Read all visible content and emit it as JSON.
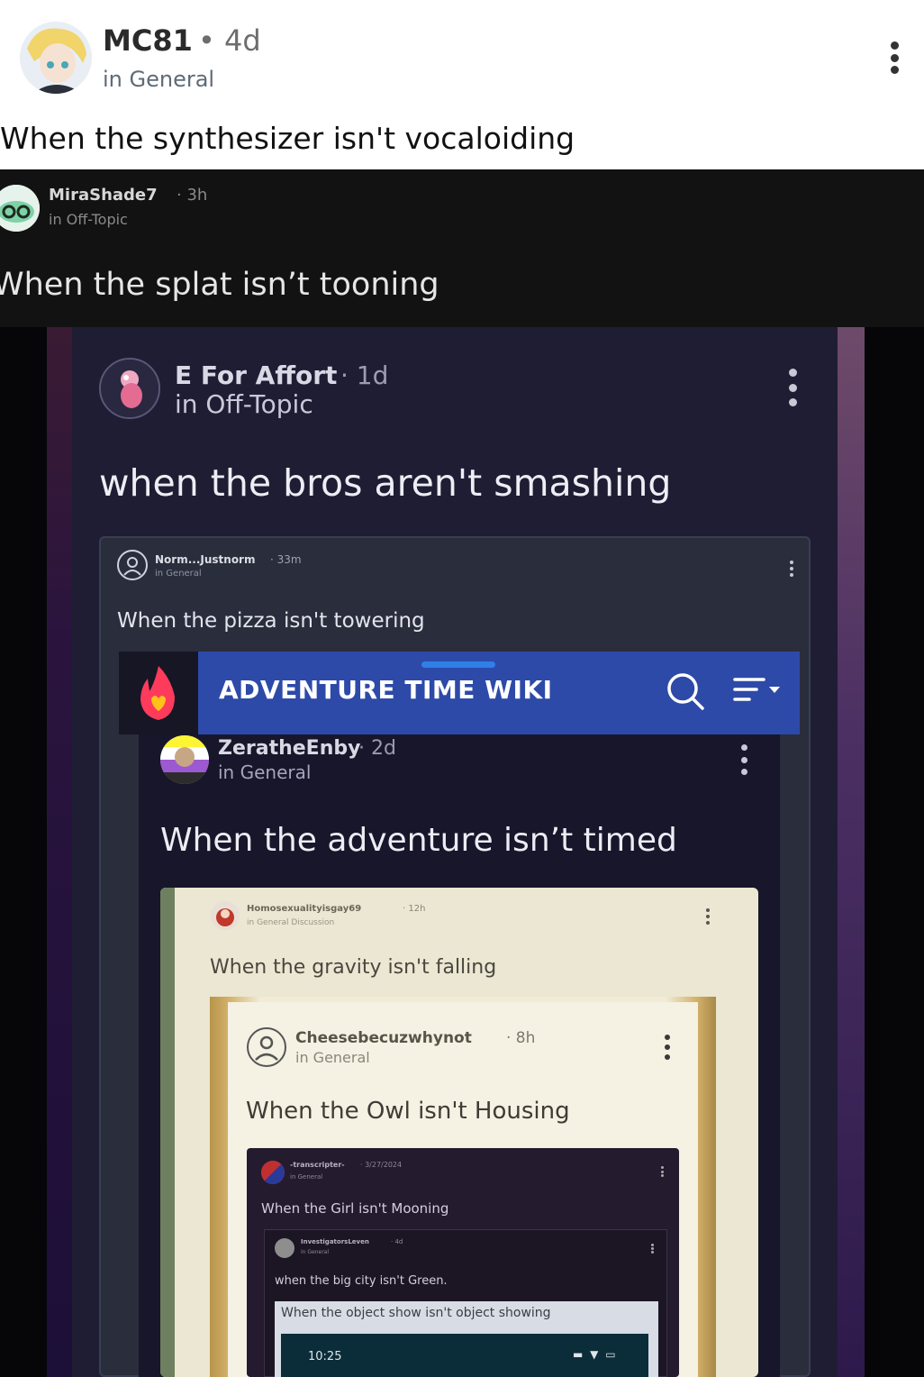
{
  "post": {
    "username": "MC81",
    "time": "• 4d",
    "category": "in General",
    "title": "When the synthesizer isn't vocaloiding"
  },
  "quotes": [
    {
      "username": "MiraShade7",
      "time": "· 3h",
      "category": "in Off-Topic",
      "title": "When the splat isn’t tooning"
    },
    {
      "username": "E For Affort",
      "time": "· 1d",
      "category": "in Off-Topic",
      "title": "when the bros aren't smashing"
    },
    {
      "username": "Norm...Justnorm",
      "time": "· 33m",
      "category": "in General",
      "title": "When the pizza isn't towering"
    },
    {
      "username": "ZeratheEnby",
      "time": "· 2d",
      "category": "in General",
      "title": "When the adventure isn’t timed"
    },
    {
      "username": "Homosexualityisgay69",
      "time": "· 12h",
      "category": "in General Discussion",
      "title": "When the gravity isn't falling"
    },
    {
      "username": "Cheesebecuzwhynot",
      "time": "· 8h",
      "category": "in General",
      "title": "When the Owl isn't Housing"
    },
    {
      "username": "-transcripter-",
      "time": "· 3/27/2024",
      "category": "in General",
      "title": "When the Girl isn't Mooning"
    },
    {
      "username": "InvestigatorsLeven",
      "time": "· 4d",
      "category": "in General",
      "title": "when the big city isn't Green."
    },
    {
      "title": "When the object show isn't object showing"
    }
  ],
  "wiki": {
    "title": "ADVENTURE TIME WIKI"
  },
  "status_bar": {
    "time": "10:25",
    "icons": "▬ ▼ ▭"
  },
  "colors": {
    "wiki_blue": "#2d4aa8",
    "panel_dark": "#1f1d33",
    "cream": "#ebe7d2"
  }
}
